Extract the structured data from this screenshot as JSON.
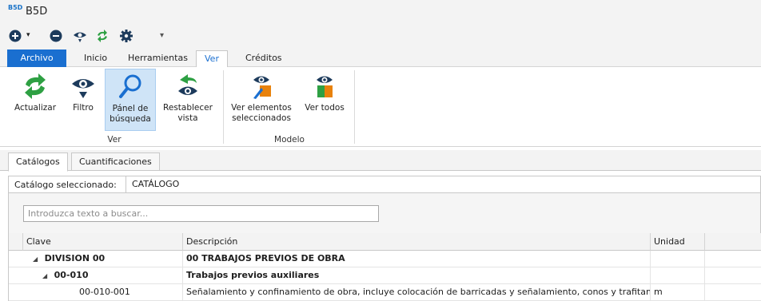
{
  "app": {
    "title": "B5D",
    "logo_text": "B5D"
  },
  "ribbon_tabs": [
    "Archivo",
    "Inicio",
    "Herramientas",
    "Ver",
    "Créditos"
  ],
  "ribbon": {
    "ver_group": {
      "label": "Ver",
      "buttons": [
        {
          "line1": "Actualizar",
          "line2": "",
          "icon": "refresh-icon"
        },
        {
          "line1": "Filtro",
          "line2": "",
          "icon": "eye-filter-icon"
        },
        {
          "line1": "Pánel de",
          "line2": "búsqueda",
          "icon": "search-icon",
          "active": true
        },
        {
          "line1": "Restablecer",
          "line2": "vista",
          "icon": "reset-view-icon"
        }
      ]
    },
    "modelo_group": {
      "label": "Modelo",
      "buttons": [
        {
          "line1": "Ver elementos",
          "line2": "seleccionados",
          "icon": "view-selected-icon"
        },
        {
          "line1": "Ver todos",
          "line2": "",
          "icon": "view-all-icon"
        }
      ]
    }
  },
  "doc_tabs": [
    "Catálogos",
    "Cuantificaciones"
  ],
  "catalog": {
    "label": "Catálogo seleccionado:",
    "value": "CATÁLOGO"
  },
  "search": {
    "placeholder": "Introduzca texto a buscar..."
  },
  "grid": {
    "columns": [
      "Clave",
      "Descripción",
      "Unidad"
    ],
    "rows": [
      {
        "clave": "DIVISION 00",
        "descripcion": "00 TRABAJOS PREVIOS DE OBRA",
        "unidad": "",
        "bold": true
      },
      {
        "clave": "00-010",
        "descripcion": "Trabajos previos auxiliares",
        "unidad": "",
        "bold": true
      },
      {
        "clave": "00-010-001",
        "descripcion": "Señalamiento y confinamiento de obra, incluye colocación de barricadas y señalamiento, conos y trafitamb...",
        "unidad": "m",
        "bold": false
      }
    ]
  },
  "colors": {
    "accent": "#1a6fd0",
    "active_button": "#cfe4f7",
    "green": "#2ea043",
    "orange": "#e8820c",
    "dark_blue": "#1d3b5c"
  }
}
